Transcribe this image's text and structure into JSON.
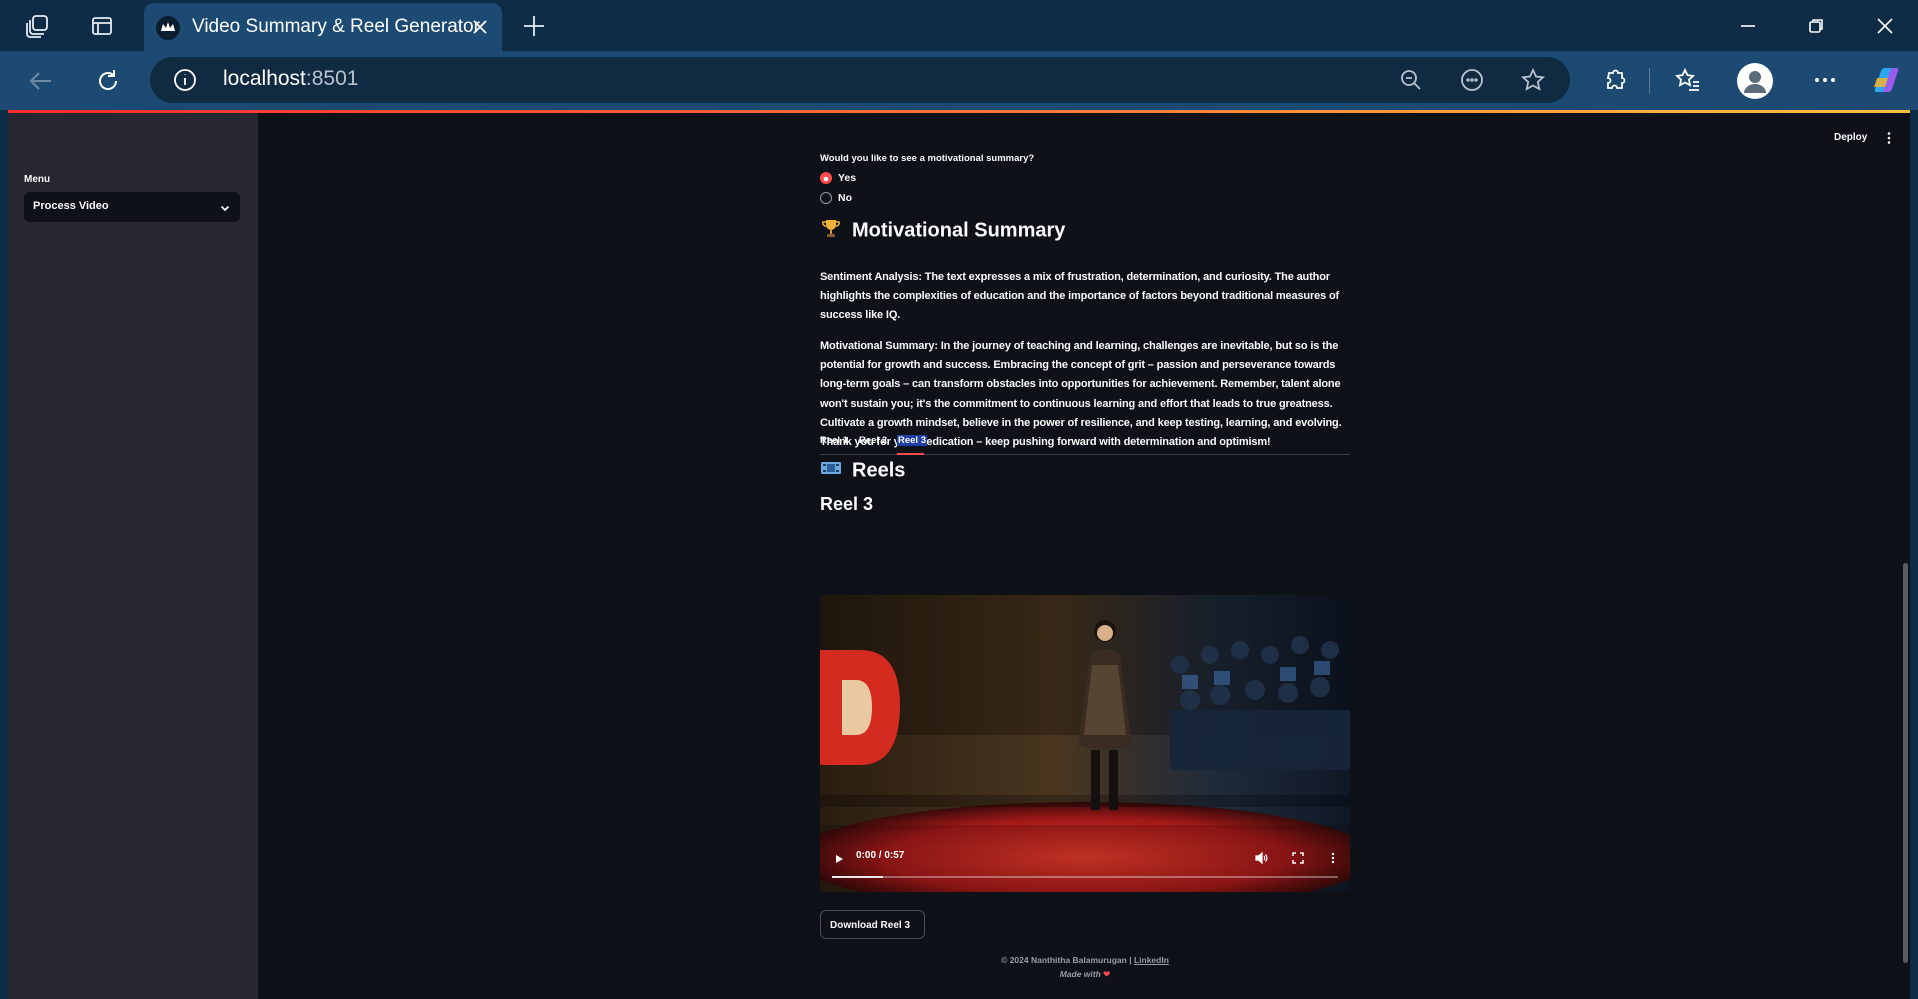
{
  "browser": {
    "tab_title": "Video Summary & Reel Generator",
    "url_host": "localhost",
    "url_port": ":8501"
  },
  "sidebar": {
    "menu_label": "Menu",
    "selected_option": "Process Video"
  },
  "header": {
    "deploy_label": "Deploy"
  },
  "main": {
    "question": "Would you like to see a motivational summary?",
    "radio_options": [
      {
        "label": "Yes",
        "selected": true
      },
      {
        "label": "No",
        "selected": false
      }
    ],
    "motivational_heading": "Motivational Summary",
    "motivational_emoji": "trophy-icon",
    "sentiment_text": "Sentiment Analysis: The text expresses a mix of frustration, determination, and curiosity. The author highlights the complexities of education and the importance of factors beyond traditional measures of success like IQ.",
    "summary_text": "Motivational Summary: In the journey of teaching and learning, challenges are inevitable, but so is the potential for growth and success. Embracing the concept of grit – passion and perseverance towards long-term goals – can transform obstacles into opportunities for achievement. Remember, talent alone won't sustain you; it's the commitment to continuous learning and effort that leads to true greatness. Cultivate a growth mindset, believe in the power of resilience, and keep testing, learning, and evolving. Thank you for your dedication – keep pushing forward with determination and optimism!",
    "reels_heading": "Reels",
    "reels_emoji": "film-icon",
    "tabs": [
      {
        "label": "Reel 1",
        "active": false
      },
      {
        "label": "Reel 2",
        "active": false
      },
      {
        "label": "Reel 3",
        "active": true
      }
    ],
    "reel_title": "Reel 3",
    "video": {
      "time_display": "0:00 / 0:57",
      "buffered_fraction": 0.1
    },
    "download_label": "Download Reel 3"
  },
  "footer": {
    "copyright": "© 2024 Nanthitha Balamurugan | ",
    "link_text": "LinkedIn",
    "made_with": "Made with "
  },
  "colors": {
    "accent": "#ff4b4b",
    "background": "#0e1117",
    "sidebar": "#262730",
    "tab_highlight": "#1f3fa8"
  }
}
